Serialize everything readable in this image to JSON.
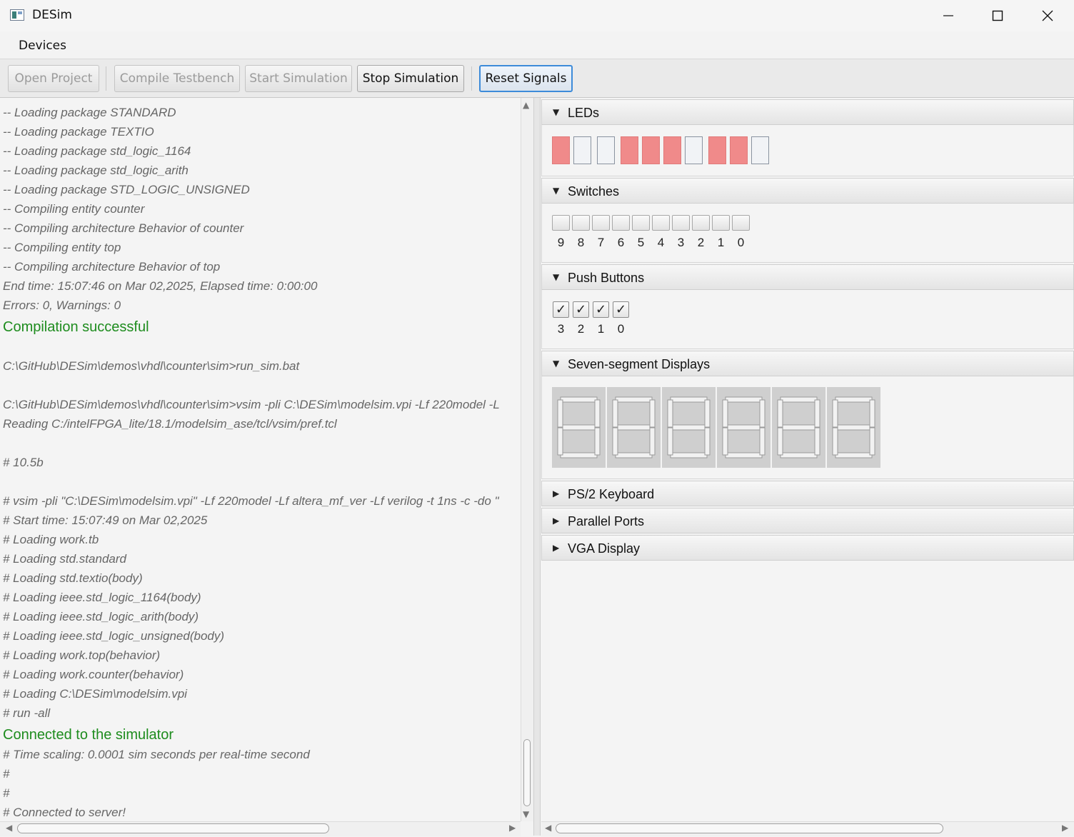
{
  "window": {
    "title": "DESim",
    "minimize_icon": "minimize-icon",
    "maximize_icon": "maximize-icon",
    "close_icon": "close-icon"
  },
  "menu": {
    "items": [
      "Devices"
    ]
  },
  "toolbar": {
    "open_project": "Open Project",
    "compile_testbench": "Compile Testbench",
    "start_simulation": "Start Simulation",
    "stop_simulation": "Stop Simulation",
    "reset_signals": "Reset Signals"
  },
  "console": {
    "lines": [
      {
        "text": "-- Loading package STANDARD",
        "type": "log"
      },
      {
        "text": "-- Loading package TEXTIO",
        "type": "log"
      },
      {
        "text": "-- Loading package std_logic_1164",
        "type": "log"
      },
      {
        "text": "-- Loading package std_logic_arith",
        "type": "log"
      },
      {
        "text": "-- Loading package STD_LOGIC_UNSIGNED",
        "type": "log"
      },
      {
        "text": "-- Compiling entity counter",
        "type": "log"
      },
      {
        "text": "-- Compiling architecture Behavior of counter",
        "type": "log"
      },
      {
        "text": "-- Compiling entity top",
        "type": "log"
      },
      {
        "text": "-- Compiling architecture Behavior of top",
        "type": "log"
      },
      {
        "text": "End time: 15:07:46 on Mar 02,2025, Elapsed time: 0:00:00",
        "type": "log"
      },
      {
        "text": "Errors: 0, Warnings: 0",
        "type": "log"
      },
      {
        "text": "Compilation successful",
        "type": "ok"
      },
      {
        "text": "",
        "type": "log"
      },
      {
        "text": "C:\\GitHub\\DESim\\demos\\vhdl\\counter\\sim>run_sim.bat",
        "type": "log"
      },
      {
        "text": "",
        "type": "log"
      },
      {
        "text": "C:\\GitHub\\DESim\\demos\\vhdl\\counter\\sim>vsim -pli C:\\DESim\\modelsim.vpi -Lf 220model -L",
        "type": "log"
      },
      {
        "text": "Reading C:/intelFPGA_lite/18.1/modelsim_ase/tcl/vsim/pref.tcl",
        "type": "log"
      },
      {
        "text": "",
        "type": "log"
      },
      {
        "text": "# 10.5b",
        "type": "log"
      },
      {
        "text": "",
        "type": "log"
      },
      {
        "text": "# vsim -pli \"C:\\DESim\\modelsim.vpi\" -Lf 220model -Lf altera_mf_ver -Lf verilog -t 1ns -c -do \"",
        "type": "log"
      },
      {
        "text": "# Start time: 15:07:49 on Mar 02,2025",
        "type": "log"
      },
      {
        "text": "# Loading work.tb",
        "type": "log"
      },
      {
        "text": "# Loading std.standard",
        "type": "log"
      },
      {
        "text": "# Loading std.textio(body)",
        "type": "log"
      },
      {
        "text": "# Loading ieee.std_logic_1164(body)",
        "type": "log"
      },
      {
        "text": "# Loading ieee.std_logic_arith(body)",
        "type": "log"
      },
      {
        "text": "# Loading ieee.std_logic_unsigned(body)",
        "type": "log"
      },
      {
        "text": "# Loading work.top(behavior)",
        "type": "log"
      },
      {
        "text": "# Loading work.counter(behavior)",
        "type": "log"
      },
      {
        "text": "# Loading C:\\DESim\\modelsim.vpi",
        "type": "log"
      },
      {
        "text": "# run -all",
        "type": "log"
      },
      {
        "text": "Connected to the simulator",
        "type": "ok"
      },
      {
        "text": "# Time scaling: 0.0001 sim seconds per real-time second",
        "type": "log"
      },
      {
        "text": "#",
        "type": "log"
      },
      {
        "text": "#",
        "type": "log"
      },
      {
        "text": "# Connected to server!",
        "type": "log"
      }
    ]
  },
  "panels": {
    "leds": {
      "title": "LEDs",
      "expanded": true,
      "states": [
        1,
        0,
        0,
        1,
        1,
        1,
        0,
        1,
        1,
        0
      ],
      "on_color": "#f08a8a"
    },
    "switches": {
      "title": "Switches",
      "expanded": true,
      "labels": [
        "9",
        "8",
        "7",
        "6",
        "5",
        "4",
        "3",
        "2",
        "1",
        "0"
      ]
    },
    "push_buttons": {
      "title": "Push Buttons",
      "expanded": true,
      "labels": [
        "3",
        "2",
        "1",
        "0"
      ],
      "checked": [
        true,
        true,
        true,
        true
      ],
      "check_glyph": "✓"
    },
    "seven_segment": {
      "title": "Seven-segment Displays",
      "expanded": true,
      "count": 6
    },
    "ps2_keyboard": {
      "title": "PS/2 Keyboard",
      "expanded": false
    },
    "parallel_ports": {
      "title": "Parallel Ports",
      "expanded": false
    },
    "vga_display": {
      "title": "VGA Display",
      "expanded": false
    }
  }
}
